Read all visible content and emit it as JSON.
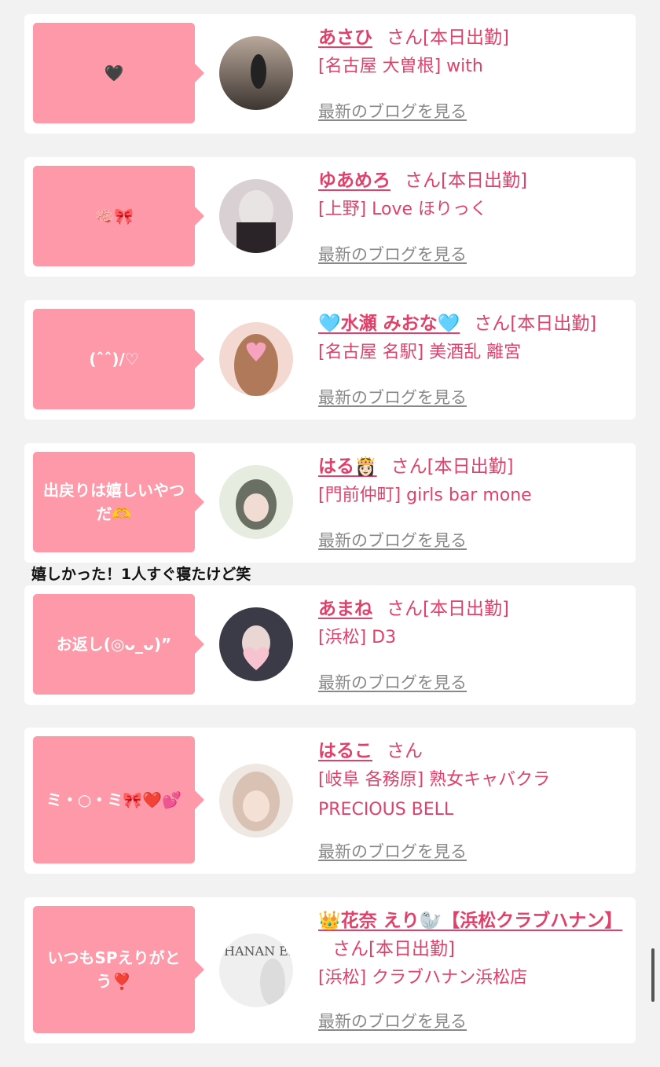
{
  "san_label": "さん",
  "blog_link": "最新のブログを見る",
  "caption": "嬉しかった！1人すぐ寝たけど笑",
  "entries": [
    {
      "bubble": "🖤",
      "name": "あさひ",
      "status": "[本日出勤]",
      "shop": "[名古屋 大曽根] with",
      "avatar_colors": [
        "#b9a89b",
        "#3d3530"
      ]
    },
    {
      "bubble": "🧠🎀",
      "name": "ゆあめろ",
      "status": "[本日出勤]",
      "shop": "[上野] Love ほりっく",
      "avatar_colors": [
        "#d8d0d3",
        "#2a2327"
      ]
    },
    {
      "bubble": "(ˆˆ)/♡",
      "name": "🩵水瀬 みおな🩵",
      "status": "[本日出勤]",
      "shop": "[名古屋 名駅] 美酒乱 離宮",
      "avatar_colors": [
        "#f3d9d2",
        "#b07a5a"
      ]
    },
    {
      "bubble": "出戻りは嬉しいやつだ🫶",
      "name": "はる👸🏻",
      "status": "[本日出勤]",
      "shop": "[門前仲町] girls bar mone",
      "avatar_colors": [
        "#e6ecdf",
        "#6a6f63"
      ]
    },
    {
      "bubble": "お返し(◎ᴗ_ᴗ)”",
      "name": "あまね",
      "status": "[本日出勤]",
      "shop": "[浜松] D3",
      "avatar_colors": [
        "#3b3b48",
        "#f7c3d1"
      ]
    },
    {
      "bubble": "ミ・○・ミ🎀❤️💕",
      "name": "はるこ",
      "status": "",
      "shop": "[岐阜 各務原]  熟女キャバクラ PRECIOUS BELL",
      "avatar_colors": [
        "#efe7e2",
        "#c9a793"
      ]
    },
    {
      "bubble": "いつもSPえりがとう❣️",
      "name": "👑花奈 えり🦭【浜松クラブハナン】",
      "status": "[本日出勤]",
      "shop": "[浜松] クラブハナン浜松店",
      "avatar_colors": [
        "#efefef",
        "#555555"
      ],
      "avatar_text": "HANAN ERI"
    }
  ]
}
